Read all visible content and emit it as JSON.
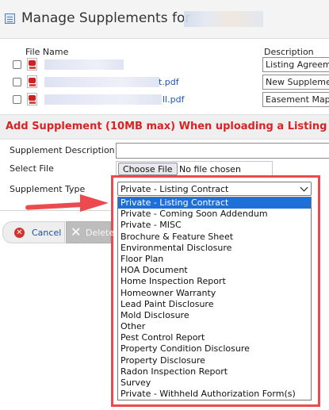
{
  "window": {
    "title": "Manage Supplements for"
  },
  "table": {
    "file_name_header": "File Name",
    "description_header": "Description",
    "rows": [
      {
        "file_suffix": "",
        "description": "Listing Agreement"
      },
      {
        "file_suffix": "t.pdf",
        "description": "New Supplement"
      },
      {
        "file_suffix": "ll.pdf",
        "description": "Easement Map"
      }
    ]
  },
  "add_section": {
    "heading": "Add Supplement (10MB max) When uploading a Listing"
  },
  "form": {
    "description_label": "Supplement Description",
    "file_label": "Select File",
    "choose_button": "Choose File",
    "no_file_text": "No file chosen",
    "type_label": "Supplement Type",
    "type_selected": "Private - Listing Contract",
    "type_options": [
      "Private - Listing Contract",
      "Private - Coming Soon Addendum",
      "Private - MISC",
      "Brochure & Feature Sheet",
      "Environmental Disclosure",
      "Floor Plan",
      "HOA Document",
      "Home Inspection Report",
      "Homeowner Warranty",
      "Lead Paint Disclosure",
      "Mold Disclosure",
      "Other",
      "Pest Control Report",
      "Property Condition Disclosure",
      "Property Disclosure",
      "Radon Inspection Report",
      "Survey",
      "Private - Withheld Authorization Form(s)"
    ]
  },
  "buttons": {
    "cancel": "Cancel",
    "delete": "Delete"
  },
  "colors": {
    "accent_red": "#d92323",
    "highlight": "#ec4a4e",
    "selected_option": "#1e6fd8",
    "link": "#1a56b5"
  },
  "icons": [
    "window-icon",
    "pdf-icon",
    "cancel-icon",
    "delete-icon",
    "chevron-down-icon",
    "arrow-annotation"
  ]
}
